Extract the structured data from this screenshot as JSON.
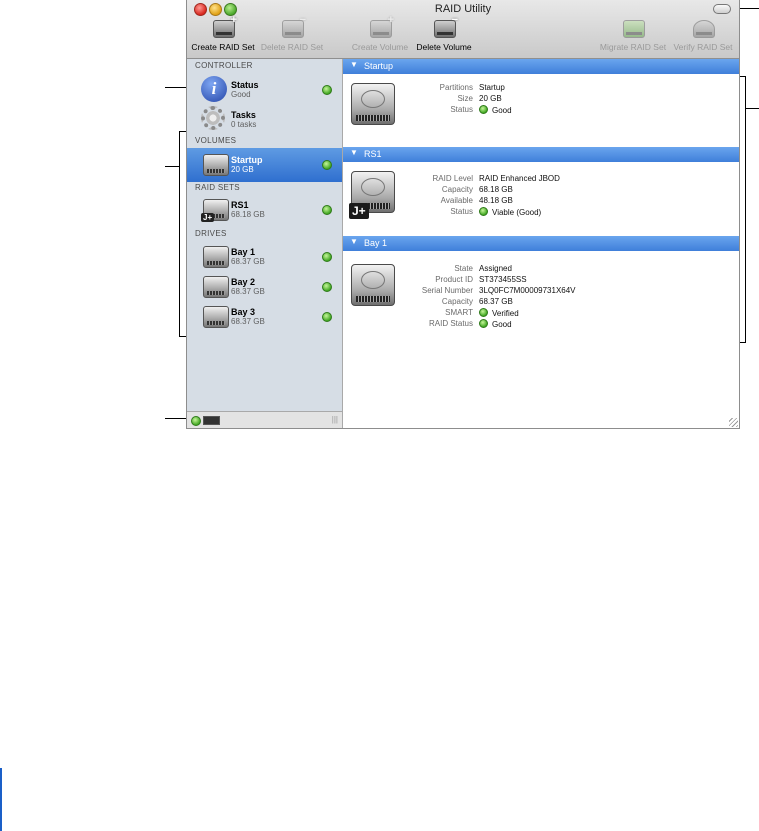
{
  "window": {
    "title": "RAID Utility"
  },
  "toolbar": [
    {
      "label": "Create RAID Set",
      "icon": "create-raid-set-icon",
      "enabled": true
    },
    {
      "label": "Delete RAID Set",
      "icon": "delete-raid-set-icon",
      "enabled": false
    },
    {
      "label": "Create Volume",
      "icon": "create-volume-icon",
      "enabled": false
    },
    {
      "label": "Delete Volume",
      "icon": "delete-volume-icon",
      "enabled": true
    },
    {
      "label": "Migrate RAID Set",
      "icon": "migrate-raid-set-icon",
      "enabled": false
    },
    {
      "label": "Verify RAID Set",
      "icon": "verify-raid-set-icon",
      "enabled": false
    }
  ],
  "sidebar": {
    "controller_header": "CONTROLLER",
    "status": {
      "name": "Status",
      "sub": "Good"
    },
    "tasks": {
      "name": "Tasks",
      "sub": "0 tasks"
    },
    "volumes_header": "VOLUMES",
    "volumes": [
      {
        "name": "Startup",
        "sub": "20 GB"
      }
    ],
    "raidsets_header": "RAID SETS",
    "raidsets": [
      {
        "name": "RS1",
        "sub": "68.18 GB",
        "badge": "J+"
      }
    ],
    "drives_header": "DRIVES",
    "drives": [
      {
        "name": "Bay 1",
        "sub": "68.37 GB"
      },
      {
        "name": "Bay 2",
        "sub": "68.37 GB"
      },
      {
        "name": "Bay 3",
        "sub": "68.37 GB"
      }
    ],
    "footer_grip": "|||"
  },
  "detail": {
    "startup": {
      "title": "Startup",
      "props": [
        {
          "label": "Partitions",
          "value": "Startup"
        },
        {
          "label": "Size",
          "value": "20 GB"
        },
        {
          "label": "Status",
          "value": "Good"
        }
      ]
    },
    "rs1": {
      "title": "RS1",
      "badge": "J+",
      "props": [
        {
          "label": "RAID Level",
          "value": "RAID Enhanced JBOD"
        },
        {
          "label": "Capacity",
          "value": "68.18 GB"
        },
        {
          "label": "Available",
          "value": "48.18 GB"
        },
        {
          "label": "Status",
          "value": "Viable (Good)"
        }
      ]
    },
    "bay1": {
      "title": "Bay 1",
      "props": [
        {
          "label": "State",
          "value": "Assigned"
        },
        {
          "label": "Product ID",
          "value": "ST373455SS"
        },
        {
          "label": "Serial Number",
          "value": "3LQ0FC7M00009731X64V"
        },
        {
          "label": "Capacity",
          "value": "68.37 GB"
        },
        {
          "label": "SMART",
          "value": "Verified"
        },
        {
          "label": "RAID Status",
          "value": "Good"
        }
      ]
    }
  },
  "colors": {
    "selection": "#3a7bd5",
    "status_good": "#42a823",
    "section_header": "#4a88e0"
  }
}
